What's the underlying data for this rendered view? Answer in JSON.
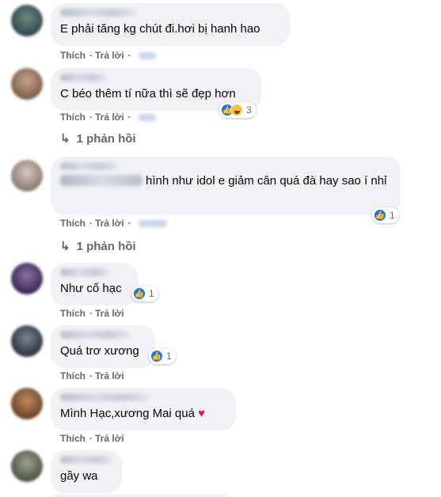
{
  "actions": {
    "like": "Thích",
    "reply": "Trả lời",
    "dot": "·"
  },
  "comments": [
    {
      "text": "E phải tăng kg chút đi.hơi bị hanh hao"
    },
    {
      "text": "C béo thêm tí nữa thì sẽ đẹp hơn",
      "reaction_count": "3",
      "replies": "1 phản hồi"
    },
    {
      "text": "hình như idol e giảm cân quá đà hay sao í nhỉ",
      "reaction_count": "1",
      "replies": "1 phản hồi"
    },
    {
      "text": "Như cố hạc",
      "reaction_count": "1"
    },
    {
      "text": "Quá trơ xương",
      "reaction_count": "1"
    },
    {
      "text": "Mình Hạc,xương Mai quá",
      "emoji": "♥"
    },
    {
      "text": "gầy wa"
    }
  ],
  "reply_arrow": "↳",
  "colors": {
    "like_blue": "#1877f2",
    "bubble_bg": "#f0f2f5",
    "meta_gray": "#65676b",
    "heart_red": "#e41e3f"
  },
  "icons": [
    "like-icon",
    "haha-icon",
    "reply-arrow-icon",
    "heart-icon"
  ]
}
